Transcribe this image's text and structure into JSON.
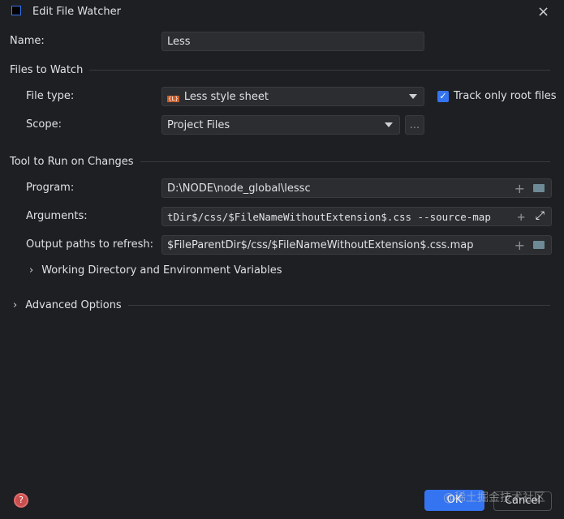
{
  "title": "Edit File Watcher",
  "name": {
    "label": "Name:",
    "value": "Less"
  },
  "files_to_watch": {
    "heading": "Files to Watch",
    "file_type_label": "File type:",
    "file_type_value": "Less style sheet",
    "file_type_icon_text": "{L}",
    "track_root_label": "Track only root files",
    "track_root_checked": true,
    "scope_label": "Scope:",
    "scope_value": "Project Files",
    "browse_label": "..."
  },
  "tool": {
    "heading": "Tool to Run on Changes",
    "program_label": "Program:",
    "program_value": "D:\\NODE\\node_global\\lessc",
    "arguments_label": "Arguments:",
    "arguments_value": "tDir$/css/$FileNameWithoutExtension$.css --source-map",
    "output_label": "Output paths to refresh:",
    "output_value": "$FileParentDir$/css/$FileNameWithoutExtension$.css.map",
    "working_dir_label": "Working Directory and Environment Variables"
  },
  "advanced_label": "Advanced Options",
  "buttons": {
    "ok": "OK",
    "cancel": "Cancel",
    "help": "?"
  },
  "watermark": "@稀土掘金技术社区",
  "colors": {
    "accent": "#3574f0",
    "bg": "#1e1f22",
    "field": "#2b2d30"
  }
}
